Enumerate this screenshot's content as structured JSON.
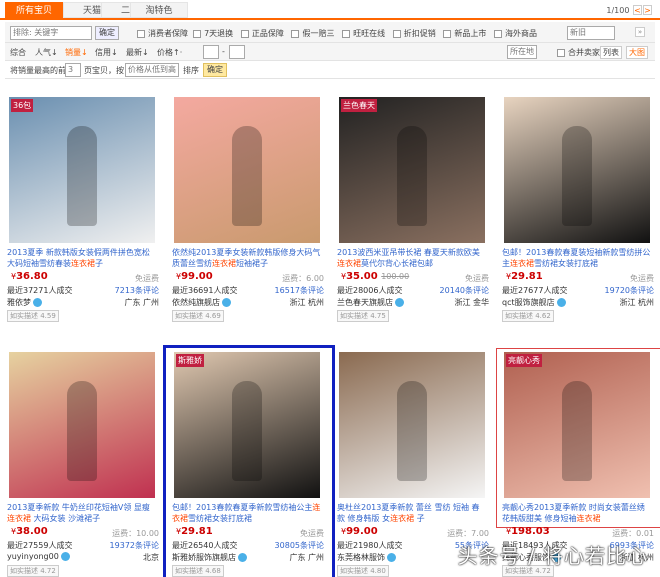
{
  "tabs": [
    "所有宝贝",
    "天猫",
    "二手",
    "淘特色"
  ],
  "pager": {
    "text": "1/100",
    "prev": "<",
    "next": ">"
  },
  "filter": {
    "search_placeholder": "排除: 关键字",
    "confirm": "确定",
    "checks": [
      "消费者保障",
      "7天退换",
      "正品保障",
      "假一赔三",
      "旺旺在线",
      "折扣促销",
      "新品上市",
      "海外商品"
    ],
    "condition": "新旧",
    "sorts": [
      "综合",
      "人气",
      "销量",
      "信用",
      "最新",
      "价格"
    ],
    "location": "所在地",
    "merge": "合并卖家",
    "list_view": "列表",
    "grid_view": "大图",
    "range_sep": "-",
    "row3": {
      "prefix": "将销量最高的前",
      "pages": "3",
      "mid": "页宝贝，按",
      "order": "价格从低到高",
      "suffix": "排序",
      "confirm": "确定"
    }
  },
  "products": [
    {
      "title": "2013夏季 新款韩版女装假两件拼色宽松大码短袖雪纺春装",
      "hl": "连衣裙",
      "tail": "子",
      "price": "36.80",
      "orig": "",
      "ship": "免运费",
      "sold": "最近37271人成交",
      "reviews": "7213条评论",
      "shop": "雅依梦",
      "loc": "广东 广州",
      "badge": "如实描述 4.59",
      "tag": "36包",
      "img": [
        "#6a8fb0",
        "#f0f0f0"
      ]
    },
    {
      "title": "依然纯2013夏季女装新款韩版修身大码气质蕾丝雪纺",
      "hl": "连衣裙",
      "tail": "短袖裙子",
      "price": "99.00",
      "orig": "",
      "ship": "运费：6.00",
      "sold": "最近36691人成交",
      "reviews": "16517条评论",
      "shop": "依然纯旗舰店",
      "loc": "浙江 杭州",
      "badge": "如实描述 4.69",
      "tag": "",
      "img": [
        "#f4a9a0",
        "#c99a6e"
      ]
    },
    {
      "title": "2013波西米亚吊带长裙 春夏天新款欧美",
      "hl": "连衣裙",
      "tail": "莫代尔背心长裙包邮",
      "price": "35.00",
      "orig": "100.00",
      "ship": "免运费",
      "sold": "最近28006人成交",
      "reviews": "20140条评论",
      "shop": "兰色春天旗舰店",
      "loc": "浙江 金华",
      "badge": "如实描述 4.75",
      "tag": "兰色春天",
      "img": [
        "#222",
        "#8a7060"
      ]
    },
    {
      "title": "包邮！2013春款春夏装短袖新款雪纺拼公主",
      "hl": "连衣裙",
      "tail": "雪纺裙女装打底裙",
      "price": "29.81",
      "orig": "",
      "ship": "免运费",
      "sold": "最近27677人成交",
      "reviews": "19720条评论",
      "shop": "qct服饰旗舰店",
      "loc": "浙江 杭州",
      "badge": "如实描述 4.62",
      "tag": "",
      "img": [
        "#e8d4c0",
        "#111"
      ]
    },
    {
      "title": "2013夏季新款 牛奶丝印花短袖V领 显瘦",
      "hl": "连衣裙",
      "tail": " 大码女装 沙滩裙子",
      "price": "38.00",
      "orig": "",
      "ship": "运费：10.00",
      "sold": "最近27559人成交",
      "reviews": "19372条评论",
      "shop": "yuyinyong00",
      "loc": "北京",
      "badge": "如实描述 4.72",
      "tag": "",
      "img": [
        "#e6d2a0",
        "#c03050"
      ]
    },
    {
      "title": "包邮！2013春款春夏季新款雪纺袖公主",
      "hl": "连衣裙",
      "tail": "雪纺裙女装打底裙",
      "price": "29.81",
      "orig": "",
      "ship": "免运费",
      "sold": "最近26540人成交",
      "reviews": "30805条评论",
      "shop": "斯雅娇服饰旗舰店",
      "loc": "广东 广州",
      "badge": "如实描述 4.68",
      "tag": "斯雅娇",
      "img": [
        "#e0c8b0",
        "#111"
      ]
    },
    {
      "title": "奥杜丝2013夏季新款 蕾丝 雪纺 短袖 春款 修身韩版 女",
      "hl": "连衣裙",
      "tail": " 子",
      "price": "99.00",
      "orig": "",
      "ship": "运费：7.00",
      "sold": "最近21980人成交",
      "reviews": "55条评论",
      "shop": "东莞格林服饰",
      "loc": "",
      "badge": "如实描述 4.80",
      "tag": "",
      "img": [
        "#8a6a50",
        "#f5f5f5"
      ]
    },
    {
      "title": "亮靓心秀2013夏季新款 时尚女装蕾丝绣花韩版甜美 修身短袖",
      "hl": "连衣裙",
      "tail": "",
      "price": "198.03",
      "orig": "",
      "ship": "运费：0.01",
      "sold": "最近18493人成交",
      "reviews": "6993条评论",
      "shop": "亮靓心秀服饰",
      "loc": "浙江 杭州",
      "badge": "如实描述 4.72",
      "tag": "亮靓心秀",
      "img": [
        "#b06050",
        "#f0c0b0"
      ]
    }
  ],
  "watermark": "头条号 / 将心若比心",
  "colors": {
    "accent": "#ff6600",
    "link": "#3366cc",
    "price": "#cc0000"
  }
}
